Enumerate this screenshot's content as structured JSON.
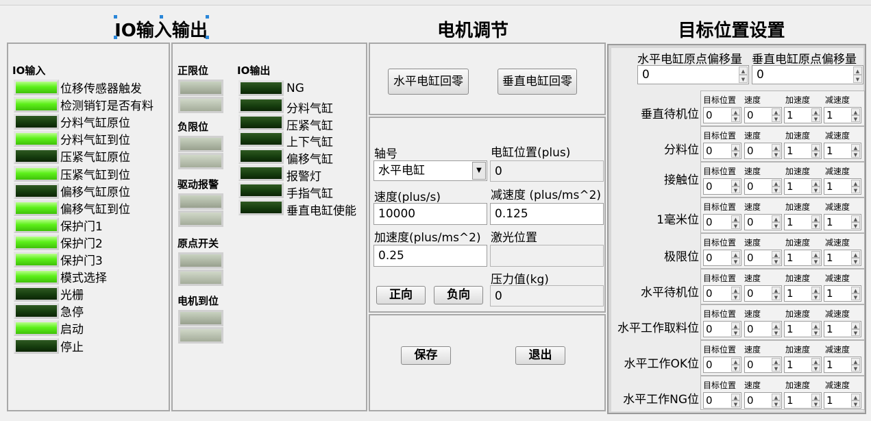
{
  "titles": {
    "io": "IO输入输出",
    "motor": "电机调节",
    "target": "目标位置设置"
  },
  "io_input": {
    "header": "IO输入",
    "items": [
      {
        "label": "位移传感器触发",
        "on": true
      },
      {
        "label": "检测销钉是否有料",
        "on": true
      },
      {
        "label": "分料气缸原位",
        "on": false
      },
      {
        "label": "分料气缸到位",
        "on": true
      },
      {
        "label": "压紧气缸原位",
        "on": false
      },
      {
        "label": "压紧气缸到位",
        "on": true
      },
      {
        "label": "偏移气缸原位",
        "on": false
      },
      {
        "label": "偏移气缸到位",
        "on": true
      },
      {
        "label": "保护门1",
        "on": true
      },
      {
        "label": "保护门2",
        "on": true
      },
      {
        "label": "保护门3",
        "on": true
      },
      {
        "label": "模式选择",
        "on": true
      },
      {
        "label": "光栅",
        "on": false
      },
      {
        "label": "急停",
        "on": false
      },
      {
        "label": "启动",
        "on": true
      },
      {
        "label": "停止",
        "on": false
      }
    ]
  },
  "limits": {
    "groups": [
      "正限位",
      "负限位",
      "驱动报警",
      "原点开关",
      "电机到位"
    ]
  },
  "io_output": {
    "header": "IO输出",
    "items": [
      "NG",
      "分料气缸",
      "压紧气缸",
      "上下气缸",
      "偏移气缸",
      "报警灯",
      "手指气缸",
      "垂直电缸使能"
    ]
  },
  "homing": {
    "horizontal": "水平电缸回零",
    "vertical": "垂直电缸回零"
  },
  "motor": {
    "axis_label": "轴号",
    "axis_value": "水平电缸",
    "position_label": "电缸位置(plus)",
    "position_value": "0",
    "speed_label": "速度(plus/s)",
    "speed_value": "10000",
    "decel_label": "减速度 (plus/ms^2)",
    "decel_value": "0.125",
    "accel_label": "加速度(plus/ms^2)",
    "accel_value": "0.25",
    "laser_label": "激光位置",
    "laser_value": "",
    "forward": "正向",
    "reverse": "负向",
    "pressure_label": "压力值(kg)",
    "pressure_value": "0"
  },
  "actions": {
    "save": "保存",
    "exit": "退出"
  },
  "target": {
    "h_offset_label": "水平电缸原点偏移量",
    "h_offset_value": "0",
    "v_offset_label": "垂直电缸原点偏移量",
    "v_offset_value": "0",
    "col_headers": [
      "目标位置",
      "速度",
      "加速度",
      "减速度"
    ],
    "rows": [
      {
        "label": "垂直待机位",
        "values": [
          "0",
          "0",
          "1",
          "1"
        ]
      },
      {
        "label": "分料位",
        "values": [
          "0",
          "0",
          "1",
          "1"
        ]
      },
      {
        "label": "接触位",
        "values": [
          "0",
          "0",
          "1",
          "1"
        ]
      },
      {
        "label": "1毫米位",
        "values": [
          "0",
          "0",
          "1",
          "1"
        ]
      },
      {
        "label": "极限位",
        "values": [
          "0",
          "0",
          "1",
          "1"
        ]
      },
      {
        "label": "水平待机位",
        "values": [
          "0",
          "0",
          "1",
          "1"
        ]
      },
      {
        "label": "水平工作取料位",
        "values": [
          "0",
          "0",
          "1",
          "1"
        ]
      },
      {
        "label": "水平工作OK位",
        "values": [
          "0",
          "0",
          "1",
          "1"
        ]
      },
      {
        "label": "水平工作NG位",
        "values": [
          "0",
          "0",
          "1",
          "1"
        ]
      }
    ]
  }
}
